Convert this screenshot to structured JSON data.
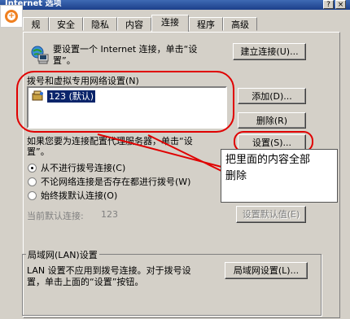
{
  "window": {
    "title": "Internet 选项",
    "help_button": "?",
    "close_button": "×"
  },
  "tabs": [
    "规",
    "安全",
    "隐私",
    "内容",
    "连接",
    "程序",
    "高级"
  ],
  "active_tab_index": 4,
  "intro": {
    "line1": "要设置一个 Internet 连接，单击“设",
    "line2": "置”。"
  },
  "buttons": {
    "setup": "建立连接(U)...",
    "add": "添加(D)...",
    "remove": "删除(R)",
    "settings": "设置(S)...",
    "set_default": "设置默认值(E)",
    "lan_settings": "局域网设置(L)..."
  },
  "dialup_group_label": "拨号和虚拟专用网络设置(N)",
  "connections": [
    {
      "name": "123 (默认)"
    }
  ],
  "proxy_text": {
    "line1": "如果您要为连接配置代理服务器，单击“设",
    "line2": "置”。"
  },
  "radio_options": [
    {
      "label": "从不进行拨号连接(C)",
      "checked": true
    },
    {
      "label": "不论网络连接是否存在都进行拨号(W)",
      "checked": false
    },
    {
      "label": "始终拨默认连接(O)",
      "checked": false
    }
  ],
  "current_default": {
    "label": "当前默认连接:",
    "value": "123"
  },
  "lan_group": {
    "title": "局域网(LAN)设置",
    "line1": "LAN 设置不应用到拨号连接。对于拨号设",
    "line2": "置，单击上面的“设置”按钮。"
  },
  "annotation": {
    "line1": "把里面的内容全部",
    "line2": "删除"
  },
  "colors": {
    "annotation_red": "#e00000",
    "selection": "#0a246a",
    "dialog_bg": "#d4d0c8"
  }
}
